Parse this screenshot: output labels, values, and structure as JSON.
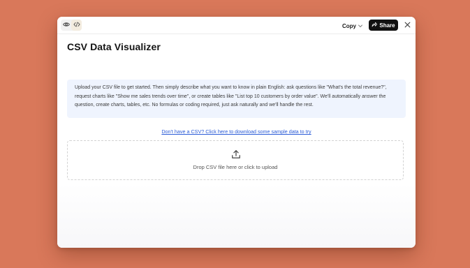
{
  "toolbar": {
    "copy_label": "Copy",
    "share_label": "Share"
  },
  "page": {
    "title": "CSV Data Visualizer",
    "intro": "Upload your CSV file to get started. Then simply describe what you want to know in plain English: ask questions like \"What's the total revenue?\", request charts like \"Show me sales trends over time\", or create tables like \"List top 10 customers by order value\". We'll automatically answer the question, create charts, tables, etc. No formulas or coding required, just ask naturally and we'll handle the rest.",
    "sample_link": "Don't have a CSV? Click here to download some sample data to try",
    "dropzone_text": "Drop CSV file here or click to upload"
  },
  "icons": {
    "preview": "eye-icon",
    "code": "code-icon",
    "copy_menu": "chevron-down-icon",
    "share": "share-arrow-icon",
    "close": "close-icon",
    "upload": "upload-icon"
  },
  "colors": {
    "background": "#d9785a",
    "share_button": "#111111",
    "info_box": "#eff4fe",
    "link": "#2a5bd7"
  }
}
